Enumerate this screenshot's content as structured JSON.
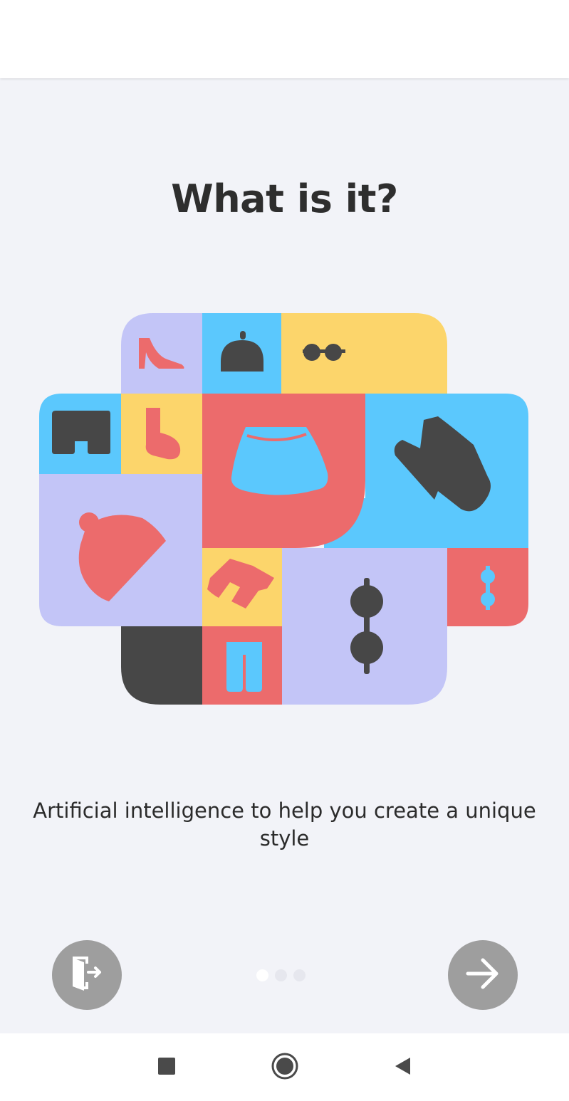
{
  "onboarding": {
    "title": "What is it?",
    "description": "Artificial intelligence to help you create a unique style",
    "page_indicator": {
      "total": 3,
      "current": 1
    }
  },
  "buttons": {
    "exit_icon": "exit-door-icon",
    "next_icon": "arrow-right-icon"
  },
  "navigation_bar": {
    "recents_icon": "square-icon",
    "home_icon": "circle-icon",
    "back_icon": "triangle-back-icon"
  },
  "colors": {
    "background": "#f2f3f8",
    "lavender": "#c3c5f7",
    "sky_blue": "#5bc8fd",
    "yellow": "#fcd56b",
    "coral": "#ec6b6c",
    "dark": "#474747",
    "button_gray": "#9e9e9e"
  }
}
